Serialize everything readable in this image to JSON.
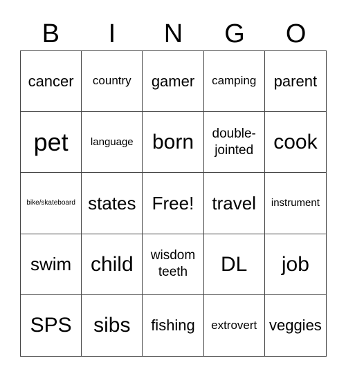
{
  "header": {
    "letters": [
      "B",
      "I",
      "N",
      "G",
      "O"
    ]
  },
  "board": {
    "rows": [
      [
        "cancer",
        "country",
        "gamer",
        "camping",
        "parent"
      ],
      [
        "pet",
        "language",
        "born",
        "double-jointed",
        "cook"
      ],
      [
        "bike/skateboard",
        "states",
        "Free!",
        "travel",
        "instrument"
      ],
      [
        "swim",
        "child",
        "wisdom teeth",
        "DL",
        "job"
      ],
      [
        "SPS",
        "sibs",
        "fishing",
        "extrovert",
        "veggies"
      ]
    ]
  }
}
